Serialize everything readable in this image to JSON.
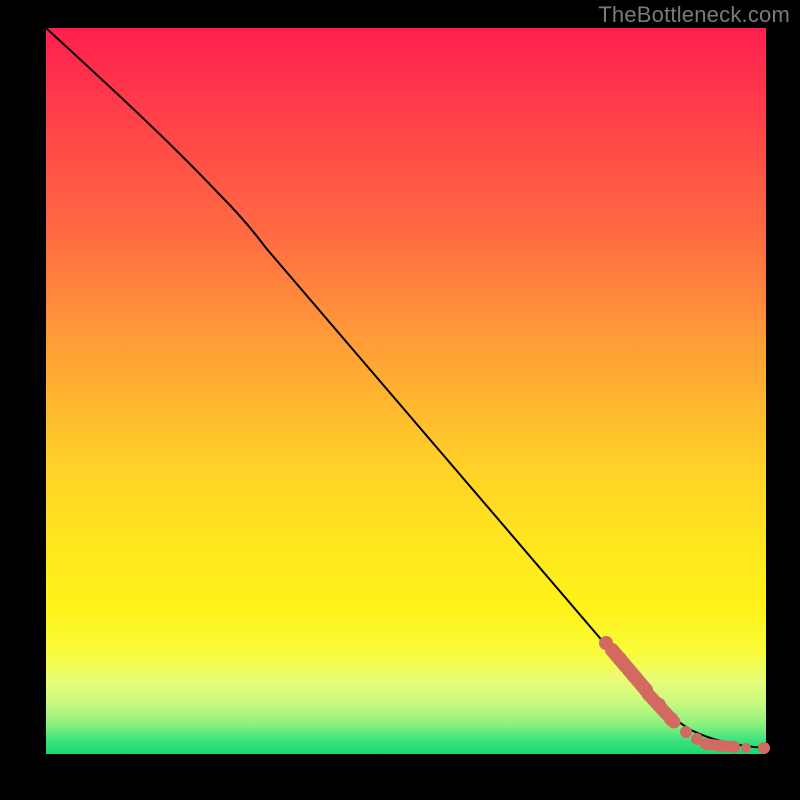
{
  "attribution": "TheBottleneck.com",
  "colors": {
    "marker": "#d36a62",
    "curve": "#000000"
  },
  "chart_data": {
    "type": "line",
    "title": "",
    "xlabel": "",
    "ylabel": "",
    "xlim": [
      0,
      100
    ],
    "ylim": [
      0,
      100
    ],
    "grid": false,
    "series": [
      {
        "name": "curve",
        "x": [
          0,
          8,
          15,
          22,
          27,
          33,
          40,
          48,
          56,
          64,
          72,
          78,
          83,
          86,
          89,
          92,
          94,
          96,
          98,
          100
        ],
        "y": [
          100,
          92,
          85,
          78,
          72,
          64,
          55,
          45,
          35,
          25,
          16,
          10,
          6,
          4,
          2.5,
          1.4,
          0.9,
          0.5,
          0.3,
          0.2
        ]
      }
    ],
    "markers": {
      "name": "bottom-right cluster",
      "points": [
        {
          "x": 78,
          "y": 19
        },
        {
          "x": 79,
          "y": 17
        },
        {
          "x": 80,
          "y": 16
        },
        {
          "x": 81,
          "y": 14
        },
        {
          "x": 82,
          "y": 12
        },
        {
          "x": 83,
          "y": 10
        },
        {
          "x": 84,
          "y": 8
        },
        {
          "x": 85,
          "y": 6.5
        },
        {
          "x": 86,
          "y": 5
        },
        {
          "x": 87,
          "y": 4
        },
        {
          "x": 88,
          "y": 3
        },
        {
          "x": 90,
          "y": 1.5
        },
        {
          "x": 92,
          "y": 1.0
        },
        {
          "x": 93,
          "y": 0.9
        },
        {
          "x": 94,
          "y": 0.8
        },
        {
          "x": 96,
          "y": 0.6
        },
        {
          "x": 97,
          "y": 0.5
        },
        {
          "x": 98,
          "y": 0.4
        },
        {
          "x": 100,
          "y": 0.3
        }
      ]
    }
  }
}
